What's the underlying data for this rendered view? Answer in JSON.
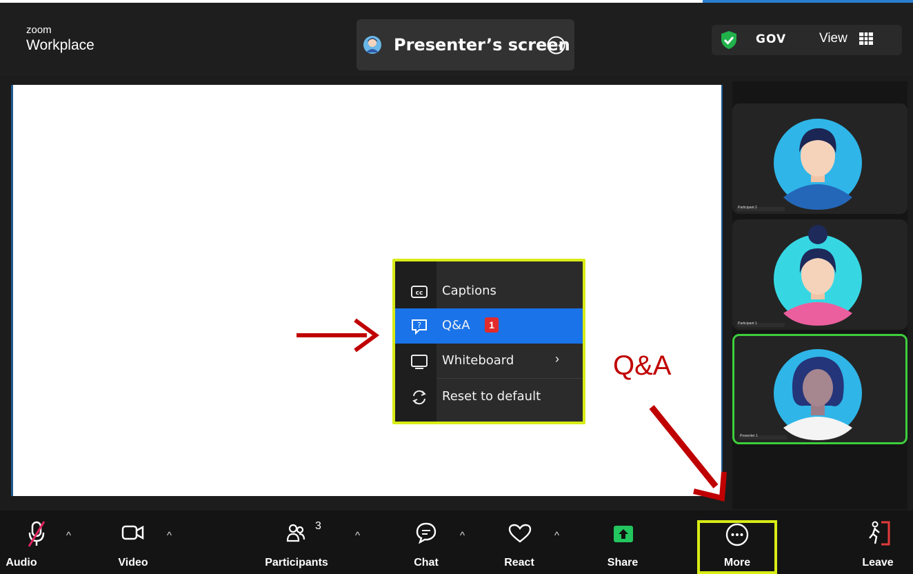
{
  "window": {
    "brand_small": "zoom",
    "brand_big": "Workplace",
    "presenter_title": "Presenter’s screen",
    "security_label": "GOV",
    "view_label": "View"
  },
  "menu": {
    "items": [
      {
        "label": "Captions",
        "icon": "captions-icon"
      },
      {
        "label": "Q&A",
        "icon": "qa-icon",
        "badge": "1",
        "selected": true
      },
      {
        "label": "Whiteboard",
        "icon": "whiteboard-icon",
        "chevron": "›"
      },
      {
        "label": "Reset to default",
        "icon": "reset-icon"
      }
    ]
  },
  "participants": [
    {
      "name": "Participant 2"
    },
    {
      "name": "Participant 1"
    },
    {
      "name": "Presenter 1",
      "active": true
    }
  ],
  "annotation": {
    "label": "Q&A",
    "color": "#c00000"
  },
  "toolbar": {
    "audio": "Audio",
    "video": "Video",
    "participants": "Participants",
    "participants_count": "3",
    "chat": "Chat",
    "react": "React",
    "share": "Share",
    "more": "More",
    "leave": "Leave",
    "caret": "^"
  },
  "colors": {
    "highlight": "#d8ec16",
    "accent_blue": "#1a73e8",
    "active_border": "#3ccf3c",
    "share_green": "#22c55e"
  }
}
